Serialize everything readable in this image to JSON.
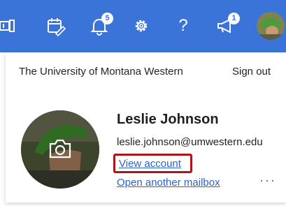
{
  "header": {
    "icons": [
      "teams-icon",
      "calendar-edit-icon",
      "bell-icon",
      "gear-icon",
      "help-icon",
      "megaphone-icon"
    ],
    "notifications_badge": "5",
    "feedback_badge": "1",
    "help_label": "?"
  },
  "account": {
    "organization": "The University of Montana Western",
    "sign_out": "Sign out",
    "name": "Leslie Johnson",
    "email": "leslie.johnson@umwestern.edu",
    "view_account": "View account",
    "open_mailbox": "Open another mailbox",
    "more": "···"
  },
  "colors": {
    "header_bg": "#3b74d8",
    "link": "#2b63c8",
    "highlight_border": "#b0141b"
  }
}
